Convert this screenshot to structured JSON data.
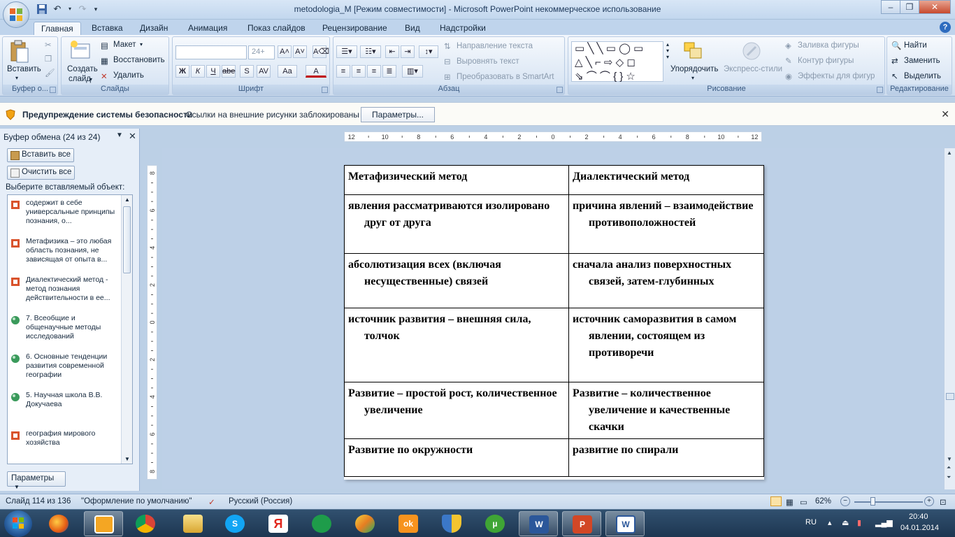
{
  "window": {
    "title": "metodologia_M [Режим совместимости] - Microsoft PowerPoint некоммерческое использование"
  },
  "tabs": [
    "Главная",
    "Вставка",
    "Дизайн",
    "Анимация",
    "Показ слайдов",
    "Рецензирование",
    "Вид",
    "Надстройки"
  ],
  "ribbon": {
    "clipboard": {
      "label": "Буфер о...",
      "paste": "Вставить"
    },
    "slides": {
      "label": "Слайды",
      "create": "Создать",
      "create2": "слайд",
      "layout": "Макет",
      "restore": "Восстановить",
      "delete": "Удалить"
    },
    "font": {
      "label": "Шрифт",
      "size": "24+",
      "bold": "Ж",
      "italic": "К",
      "underline": "Ч",
      "strike": "abe",
      "shadow": "S",
      "spacing": "AV",
      "case": "Aa",
      "color": "A"
    },
    "paragraph": {
      "label": "Абзац",
      "text_dir": "Направление текста",
      "align_text": "Выровнять текст",
      "smartart": "Преобразовать в SmartArt"
    },
    "drawing": {
      "label": "Рисование",
      "arrange": "Упорядочить",
      "express": "Экспресс-стили",
      "fill": "Заливка фигуры",
      "outline": "Контур фигуры",
      "effects": "Эффекты для фигур"
    },
    "editing": {
      "label": "Редактирование",
      "find": "Найти",
      "replace": "Заменить",
      "select": "Выделить"
    }
  },
  "security": {
    "title": "Предупреждение системы безопасности",
    "text": "Ссылки на внешние рисунки заблокированы",
    "button": "Параметры..."
  },
  "clipboard_pane": {
    "title": "Буфер обмена (24 из 24)",
    "paste_all": "Вставить все",
    "clear_all": "Очистить все",
    "hint": "Выберите вставляемый объект:",
    "items": [
      {
        "icon": "ppt-icon",
        "text": "содержит в себе универсальные принципы познания, о..."
      },
      {
        "icon": "ppt-icon",
        "text": "Метафизика – это любая область познания, не зависящая от опыта в..."
      },
      {
        "icon": "ppt-icon",
        "text": "Диалектический метод - метод познания действительности в ее..."
      },
      {
        "icon": "web-icon",
        "text": "7. Всеобщие и общенаучные методы исследований"
      },
      {
        "icon": "web-icon",
        "text": "6. Основные тенденции развития современной географии"
      },
      {
        "icon": "web-icon",
        "text": "5. Научная школа В.В. Докучаева"
      },
      {
        "icon": "ppt-icon",
        "text": "география мирового хозяйства"
      }
    ],
    "params": "Параметры"
  },
  "ruler": {
    "h_labels": [
      "12",
      "10",
      "8",
      "6",
      "4",
      "2",
      "0",
      "2",
      "4",
      "6",
      "8",
      "10",
      "12"
    ],
    "v_labels": [
      "8",
      "6",
      "4",
      "2",
      "0",
      "2",
      "4",
      "6",
      "8"
    ]
  },
  "slide_table": {
    "headers": [
      "Метафизический  метод",
      "Диалектический  метод"
    ],
    "rows": [
      [
        " явления рассматриваются изолировано друг от друга",
        "причина явлений – взаимодействие противоположностей"
      ],
      [
        "абсолютизация всех (включая несущественные) связей",
        "сначала анализ поверхностных связей, затем-глубинных"
      ],
      [
        "источник развития – внешняя сила, толчок",
        "источник саморазвития в самом явлении, состоящем из противоречи"
      ],
      [
        "Развитие – простой рост, количественное увеличение",
        "Развитие – количественное увеличение и качественные скачки"
      ],
      [
        "Развитие по окружности",
        " развитие по спирали"
      ]
    ]
  },
  "status": {
    "slide": "Слайд 114 из 136",
    "theme": "\"Оформление по умолчанию\"",
    "lang": "Русский (Россия)",
    "zoom": "62%"
  },
  "taskbar": {
    "lang": "RU",
    "time": "20:40",
    "date": "04.01.2014"
  },
  "colors": {
    "ribbon_bg": "#dde8f5",
    "accent": "#2e6cbf"
  }
}
